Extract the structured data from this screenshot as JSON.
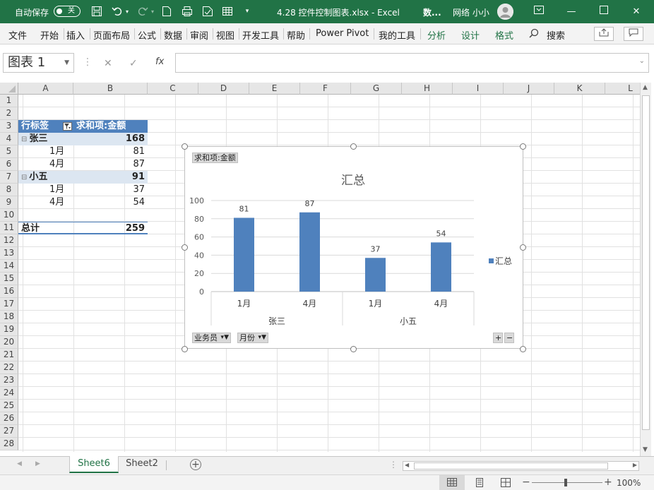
{
  "titlebar": {
    "autosave_label": "自动保存",
    "autosave_state": "关",
    "file_title": "4.28 控件控制图表.xlsx  -  Excel",
    "ribbon_display": "数...",
    "user_name": "网络 小小"
  },
  "ribbon": {
    "tabs": [
      "文件",
      "开始",
      "插入",
      "页面布局",
      "公式",
      "数据",
      "审阅",
      "视图",
      "开发工具",
      "帮助",
      "Power Pivot",
      "我的工具"
    ],
    "context_tabs": [
      "分析",
      "设计",
      "格式"
    ],
    "search_label": "搜索"
  },
  "formula_bar": {
    "name_box": "图表 1",
    "fx_label": "fx",
    "value": ""
  },
  "grid": {
    "columns": [
      "A",
      "B",
      "C",
      "D",
      "E",
      "F",
      "G",
      "H",
      "I",
      "J",
      "K",
      "L"
    ],
    "rows": [
      "1",
      "2",
      "3",
      "4",
      "5",
      "6",
      "7",
      "8",
      "9",
      "10",
      "11",
      "12",
      "13",
      "14",
      "15",
      "16",
      "17",
      "18",
      "19",
      "20",
      "21",
      "22",
      "23",
      "24",
      "25",
      "26",
      "27",
      "28"
    ]
  },
  "pivot_table": {
    "row_label_header": "行标签",
    "value_header": "求和项:金额",
    "rows": [
      {
        "label": "张三",
        "value": "168",
        "level": 0
      },
      {
        "label": "1月",
        "value": "81",
        "level": 1
      },
      {
        "label": "4月",
        "value": "87",
        "level": 1
      },
      {
        "label": "小五",
        "value": "91",
        "level": 0
      },
      {
        "label": "1月",
        "value": "37",
        "level": 1
      },
      {
        "label": "4月",
        "value": "54",
        "level": 1
      }
    ],
    "total_label": "总计",
    "total_value": "259"
  },
  "chart_data": {
    "type": "bar",
    "title": "汇总",
    "value_field_button": "求和项:金额",
    "axis_field_buttons": [
      "业务员",
      "月份"
    ],
    "categories": [
      "1月",
      "4月",
      "1月",
      "4月"
    ],
    "category_groups": [
      {
        "name": "张三",
        "span": 2
      },
      {
        "name": "小五",
        "span": 2
      }
    ],
    "series": [
      {
        "name": "汇总",
        "values": [
          81,
          87,
          37,
          54
        ],
        "color": "#4f81bd"
      }
    ],
    "ylim": [
      0,
      100
    ],
    "yticks": [
      0,
      20,
      40,
      60,
      80,
      100
    ],
    "data_labels": true,
    "grid": true,
    "legend": "right",
    "expand_collapse_buttons": [
      "+",
      "−"
    ]
  },
  "sheets": {
    "tabs": [
      "Sheet6",
      "Sheet2"
    ],
    "active": "Sheet6",
    "add_label": "+"
  },
  "status": {
    "zoom": "100%"
  }
}
